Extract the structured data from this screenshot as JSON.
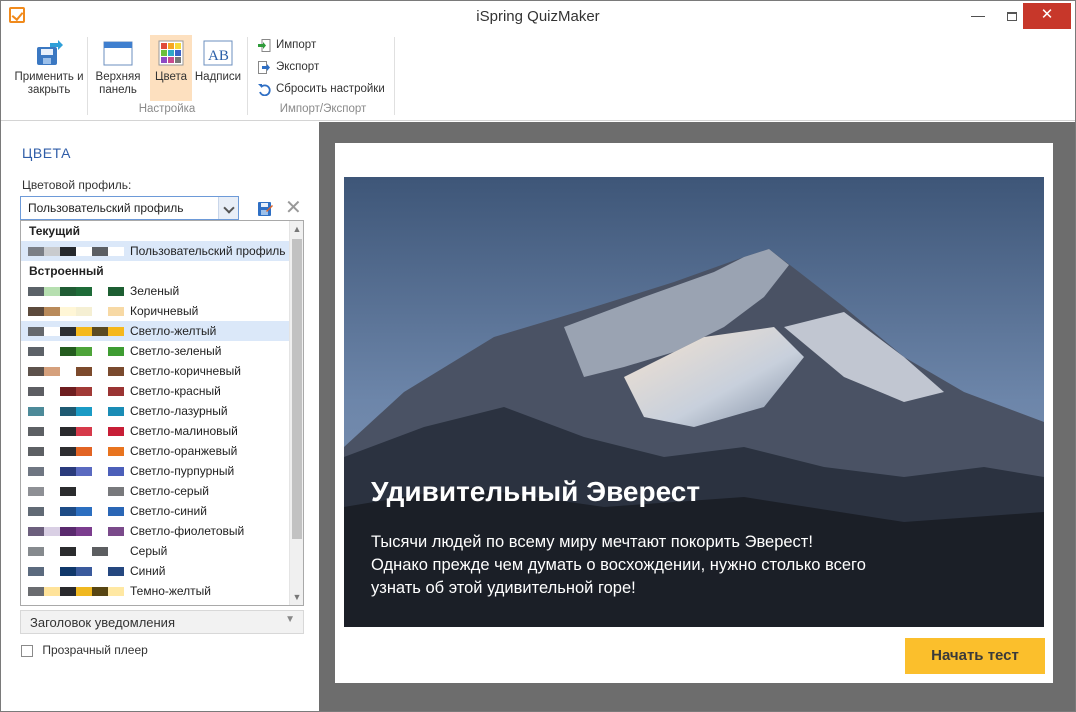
{
  "window": {
    "title": "iSpring QuizMaker",
    "minimize": "—",
    "close": "✕"
  },
  "ribbon": {
    "apply": "Применить и закрыть",
    "top_panel": "Верхняя панель",
    "colors": "Цвета",
    "labels": "Надписи",
    "group_settings": "Настройка",
    "import": "Импорт",
    "export": "Экспорт",
    "reset": "Сбросить настройки",
    "group_import_export": "Импорт/Экспорт"
  },
  "panel": {
    "title": "ЦВЕТА",
    "profile_label": "Цветовой профиль:",
    "profile_value": "Пользовательский профиль",
    "current_header": "Текущий",
    "builtin_header": "Встроенный",
    "current_item": {
      "label": "Пользовательский профиль",
      "colors": [
        "#7b7f86",
        "#c9cbce",
        "#26292d",
        "#ffffff",
        "#5c5f63",
        "#ffffff"
      ]
    },
    "builtin_items": [
      {
        "label": "Зеленый",
        "colors": [
          "#5b6268",
          "#b6dfb0",
          "#205c34",
          "#1e6b38",
          "#ffffff",
          "#1d5e32"
        ]
      },
      {
        "label": "Коричневый",
        "colors": [
          "#5c4a3c",
          "#b98a5a",
          "#fff6d6",
          "#f5efd3",
          "#ffffff",
          "#f7d9a5"
        ]
      },
      {
        "label": "Светло-желтый",
        "colors": [
          "#66696d",
          "#ffffff",
          "#2c2f33",
          "#f5b91c",
          "#5a4a22",
          "#f5b71b"
        ]
      },
      {
        "label": "Светло-зеленый",
        "colors": [
          "#5d6268",
          "#ffffff",
          "#245c1f",
          "#4ea43a",
          "#ffffff",
          "#3e9c32"
        ]
      },
      {
        "label": "Светло-коричневый",
        "colors": [
          "#5d524c",
          "#d5a07c",
          "#ffffff",
          "#7c4a2c",
          "#ffffff",
          "#7a4a2e"
        ]
      },
      {
        "label": "Светло-красный",
        "colors": [
          "#5d5e63",
          "#ffffff",
          "#6e1e20",
          "#a13a36",
          "#ffffff",
          "#9a3433"
        ]
      },
      {
        "label": "Светло-лазурный",
        "colors": [
          "#4d8a99",
          "#ffffff",
          "#1f5a72",
          "#1b9bc5",
          "#ffffff",
          "#1a8cb5"
        ]
      },
      {
        "label": "Светло-малиновый",
        "colors": [
          "#5d6064",
          "#ffffff",
          "#2a2a2d",
          "#d63a4a",
          "#ffffff",
          "#c71e36"
        ]
      },
      {
        "label": "Светло-оранжевый",
        "colors": [
          "#5d6064",
          "#ffffff",
          "#2e2e31",
          "#e26424",
          "#ffffff",
          "#e8741f"
        ]
      },
      {
        "label": "Светло-пурпурный",
        "colors": [
          "#6f7682",
          "#ffffff",
          "#2a3b7c",
          "#5a6ac0",
          "#ffffff",
          "#4c5fb9"
        ]
      },
      {
        "label": "Светло-серый",
        "colors": [
          "#8e9095",
          "#ffffff",
          "#2b2c2e",
          "#ffffff",
          "#ffffff",
          "#78797c"
        ]
      },
      {
        "label": "Светло-синий",
        "colors": [
          "#616a75",
          "#ffffff",
          "#1e4c86",
          "#2c6fc0",
          "#ffffff",
          "#2a66b5"
        ]
      },
      {
        "label": "Светло-фиолетовый",
        "colors": [
          "#6c5f7d",
          "#d9cfe4",
          "#5a2a6e",
          "#7b3d8e",
          "#ffffff",
          "#7a4a8a"
        ]
      },
      {
        "label": "Серый",
        "colors": [
          "#868a8e",
          "#ffffff",
          "#2b2c2e",
          "#ffffff",
          "#5c5e61",
          "#ffffff"
        ]
      },
      {
        "label": "Синий",
        "colors": [
          "#5b6a7e",
          "#ffffff",
          "#10386a",
          "#3a5a9c",
          "#ffffff",
          "#25477f"
        ]
      },
      {
        "label": "Темно-желтый",
        "colors": [
          "#6a6c70",
          "#ffe39a",
          "#2a2a2d",
          "#f0b820",
          "#574512",
          "#ffe8a3"
        ]
      }
    ],
    "notification_header": "Заголовок уведомления",
    "transparent_player": "Прозрачный плеер"
  },
  "preview": {
    "title": "Удивительный Эверест",
    "text": "Тысячи людей по всему миру мечтают покорить Эверест! Однако прежде чем думать о восхождении, нужно столько всего узнать об этой удивительной горе!",
    "start_button": "Начать тест",
    "start_color": "#fbbf2c"
  }
}
